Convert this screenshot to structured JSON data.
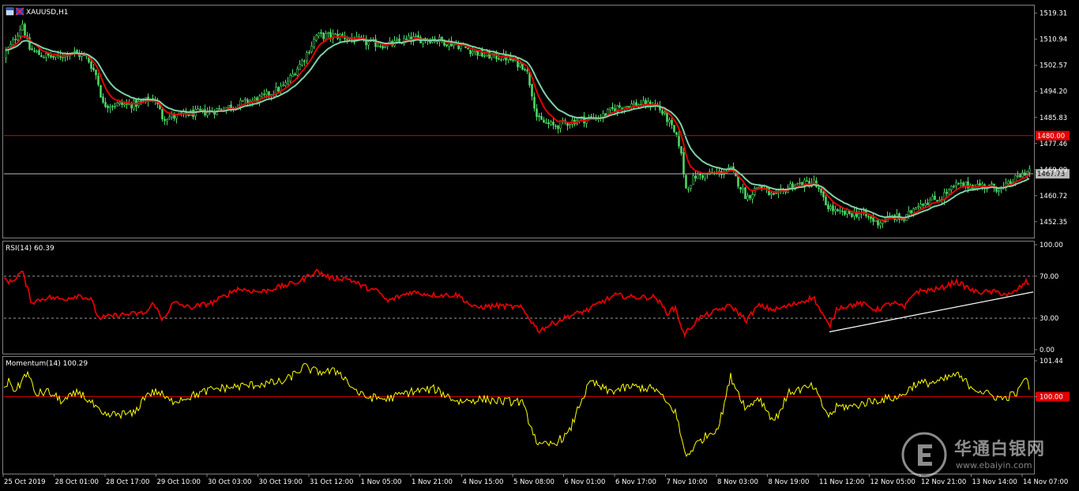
{
  "chart_data": [
    {
      "type": "candlestick",
      "title": "XAUUSD,H1",
      "ylim": [
        1447.5,
        1521.5
      ],
      "y_ticks": [
        "1519.31",
        "1510.94",
        "1502.57",
        "1494.20",
        "1485.83",
        "1477.46",
        "1469.09",
        "1460.72",
        "1452.35"
      ],
      "horizontal_lines": [
        {
          "value": 1480.0,
          "label": "1480.00",
          "color": "#e10000"
        },
        {
          "value": 1467.73,
          "label": "1467.73",
          "color": "#b8b8b8"
        }
      ],
      "moving_averages": [
        {
          "color": "#e10000"
        },
        {
          "color": "#7fd1a8"
        }
      ],
      "close_anchors": [
        {
          "x": 0,
          "y": 1505
        },
        {
          "x": 14,
          "y": 1509
        },
        {
          "x": 28,
          "y": 1516
        },
        {
          "x": 36,
          "y": 1508
        },
        {
          "x": 50,
          "y": 1506
        },
        {
          "x": 70,
          "y": 1505
        },
        {
          "x": 90,
          "y": 1507
        },
        {
          "x": 110,
          "y": 1505
        },
        {
          "x": 122,
          "y": 1499
        },
        {
          "x": 130,
          "y": 1490
        },
        {
          "x": 150,
          "y": 1490
        },
        {
          "x": 170,
          "y": 1490
        },
        {
          "x": 195,
          "y": 1492
        },
        {
          "x": 205,
          "y": 1486
        },
        {
          "x": 220,
          "y": 1486
        },
        {
          "x": 240,
          "y": 1487
        },
        {
          "x": 270,
          "y": 1488
        },
        {
          "x": 300,
          "y": 1490
        },
        {
          "x": 330,
          "y": 1492
        },
        {
          "x": 360,
          "y": 1496
        },
        {
          "x": 385,
          "y": 1505
        },
        {
          "x": 400,
          "y": 1512
        },
        {
          "x": 430,
          "y": 1512
        },
        {
          "x": 460,
          "y": 1510
        },
        {
          "x": 490,
          "y": 1509
        },
        {
          "x": 520,
          "y": 1511
        },
        {
          "x": 550,
          "y": 1511
        },
        {
          "x": 580,
          "y": 1509
        },
        {
          "x": 610,
          "y": 1506
        },
        {
          "x": 640,
          "y": 1505
        },
        {
          "x": 665,
          "y": 1502
        },
        {
          "x": 672,
          "y": 1495
        },
        {
          "x": 680,
          "y": 1485
        },
        {
          "x": 700,
          "y": 1483
        },
        {
          "x": 730,
          "y": 1485
        },
        {
          "x": 760,
          "y": 1486
        },
        {
          "x": 780,
          "y": 1489
        },
        {
          "x": 800,
          "y": 1490
        },
        {
          "x": 830,
          "y": 1490
        },
        {
          "x": 845,
          "y": 1485
        },
        {
          "x": 860,
          "y": 1477
        },
        {
          "x": 868,
          "y": 1463
        },
        {
          "x": 880,
          "y": 1467
        },
        {
          "x": 910,
          "y": 1468
        },
        {
          "x": 925,
          "y": 1469
        },
        {
          "x": 945,
          "y": 1460
        },
        {
          "x": 960,
          "y": 1464
        },
        {
          "x": 980,
          "y": 1460
        },
        {
          "x": 1000,
          "y": 1464
        },
        {
          "x": 1030,
          "y": 1465
        },
        {
          "x": 1045,
          "y": 1458
        },
        {
          "x": 1060,
          "y": 1455
        },
        {
          "x": 1090,
          "y": 1455
        },
        {
          "x": 1110,
          "y": 1452
        },
        {
          "x": 1130,
          "y": 1454
        },
        {
          "x": 1145,
          "y": 1453
        },
        {
          "x": 1160,
          "y": 1458
        },
        {
          "x": 1190,
          "y": 1460
        },
        {
          "x": 1210,
          "y": 1464
        },
        {
          "x": 1240,
          "y": 1464
        },
        {
          "x": 1270,
          "y": 1463
        },
        {
          "x": 1290,
          "y": 1467
        },
        {
          "x": 1302,
          "y": 1469
        }
      ]
    },
    {
      "type": "line",
      "title": "RSI(14) 60.39",
      "ylim": [
        0,
        100
      ],
      "y_ticks": [
        "100.00",
        "70.00",
        "30.00",
        "0.00"
      ],
      "levels": [
        70,
        30
      ],
      "series_color": "#e10000",
      "trendline": {
        "from": {
          "x": 1050,
          "y": 17
        },
        "to": {
          "x": 1308,
          "y": 55
        },
        "color": "#ffffff"
      },
      "anchors": [
        {
          "x": 0,
          "y": 70
        },
        {
          "x": 14,
          "y": 64
        },
        {
          "x": 28,
          "y": 75
        },
        {
          "x": 40,
          "y": 45
        },
        {
          "x": 60,
          "y": 50
        },
        {
          "x": 80,
          "y": 48
        },
        {
          "x": 100,
          "y": 52
        },
        {
          "x": 115,
          "y": 48
        },
        {
          "x": 125,
          "y": 30
        },
        {
          "x": 150,
          "y": 33
        },
        {
          "x": 185,
          "y": 35
        },
        {
          "x": 195,
          "y": 45
        },
        {
          "x": 205,
          "y": 28
        },
        {
          "x": 220,
          "y": 45
        },
        {
          "x": 240,
          "y": 40
        },
        {
          "x": 270,
          "y": 45
        },
        {
          "x": 300,
          "y": 58
        },
        {
          "x": 330,
          "y": 55
        },
        {
          "x": 355,
          "y": 60
        },
        {
          "x": 380,
          "y": 65
        },
        {
          "x": 400,
          "y": 75
        },
        {
          "x": 420,
          "y": 68
        },
        {
          "x": 440,
          "y": 68
        },
        {
          "x": 460,
          "y": 60
        },
        {
          "x": 480,
          "y": 55
        },
        {
          "x": 490,
          "y": 46
        },
        {
          "x": 520,
          "y": 55
        },
        {
          "x": 550,
          "y": 52
        },
        {
          "x": 580,
          "y": 52
        },
        {
          "x": 600,
          "y": 40
        },
        {
          "x": 630,
          "y": 42
        },
        {
          "x": 660,
          "y": 40
        },
        {
          "x": 670,
          "y": 30
        },
        {
          "x": 682,
          "y": 18
        },
        {
          "x": 700,
          "y": 25
        },
        {
          "x": 720,
          "y": 32
        },
        {
          "x": 745,
          "y": 38
        },
        {
          "x": 760,
          "y": 45
        },
        {
          "x": 780,
          "y": 52
        },
        {
          "x": 800,
          "y": 50
        },
        {
          "x": 830,
          "y": 50
        },
        {
          "x": 845,
          "y": 35
        },
        {
          "x": 855,
          "y": 40
        },
        {
          "x": 866,
          "y": 14
        },
        {
          "x": 885,
          "y": 30
        },
        {
          "x": 910,
          "y": 38
        },
        {
          "x": 925,
          "y": 42
        },
        {
          "x": 945,
          "y": 28
        },
        {
          "x": 960,
          "y": 42
        },
        {
          "x": 980,
          "y": 38
        },
        {
          "x": 1000,
          "y": 42
        },
        {
          "x": 1030,
          "y": 50
        },
        {
          "x": 1040,
          "y": 35
        },
        {
          "x": 1050,
          "y": 22
        },
        {
          "x": 1060,
          "y": 40
        },
        {
          "x": 1090,
          "y": 44
        },
        {
          "x": 1110,
          "y": 38
        },
        {
          "x": 1130,
          "y": 45
        },
        {
          "x": 1145,
          "y": 40
        },
        {
          "x": 1158,
          "y": 55
        },
        {
          "x": 1190,
          "y": 58
        },
        {
          "x": 1210,
          "y": 65
        },
        {
          "x": 1235,
          "y": 55
        },
        {
          "x": 1260,
          "y": 55
        },
        {
          "x": 1280,
          "y": 52
        },
        {
          "x": 1300,
          "y": 65
        },
        {
          "x": 1304,
          "y": 60
        }
      ]
    },
    {
      "type": "line",
      "title": "Momentum(14) 100.29",
      "ylim": [
        97.0,
        101.44
      ],
      "y_ticks": [
        "101.44",
        "100.00"
      ],
      "levels": [
        100.0
      ],
      "level_color": "#e10000",
      "series_color": "#ffff00",
      "anchors": [
        {
          "x": 0,
          "y": 100.3
        },
        {
          "x": 12,
          "y": 100.6
        },
        {
          "x": 20,
          "y": 100.2
        },
        {
          "x": 34,
          "y": 101.0
        },
        {
          "x": 45,
          "y": 100.1
        },
        {
          "x": 60,
          "y": 100.2
        },
        {
          "x": 80,
          "y": 99.8
        },
        {
          "x": 100,
          "y": 100.2
        },
        {
          "x": 120,
          "y": 99.6
        },
        {
          "x": 130,
          "y": 99.2
        },
        {
          "x": 150,
          "y": 99.3
        },
        {
          "x": 170,
          "y": 99.3
        },
        {
          "x": 185,
          "y": 100.1
        },
        {
          "x": 200,
          "y": 100.2
        },
        {
          "x": 215,
          "y": 99.8
        },
        {
          "x": 240,
          "y": 100.0
        },
        {
          "x": 270,
          "y": 100.3
        },
        {
          "x": 300,
          "y": 100.4
        },
        {
          "x": 330,
          "y": 100.5
        },
        {
          "x": 360,
          "y": 100.6
        },
        {
          "x": 385,
          "y": 101.2
        },
        {
          "x": 400,
          "y": 101.0
        },
        {
          "x": 430,
          "y": 101.0
        },
        {
          "x": 445,
          "y": 100.4
        },
        {
          "x": 460,
          "y": 100.0
        },
        {
          "x": 490,
          "y": 99.9
        },
        {
          "x": 520,
          "y": 100.2
        },
        {
          "x": 550,
          "y": 100.3
        },
        {
          "x": 580,
          "y": 99.8
        },
        {
          "x": 610,
          "y": 99.9
        },
        {
          "x": 640,
          "y": 99.8
        },
        {
          "x": 660,
          "y": 99.8
        },
        {
          "x": 670,
          "y": 99.0
        },
        {
          "x": 682,
          "y": 98.0
        },
        {
          "x": 700,
          "y": 98.1
        },
        {
          "x": 720,
          "y": 98.5
        },
        {
          "x": 735,
          "y": 99.8
        },
        {
          "x": 748,
          "y": 100.6
        },
        {
          "x": 770,
          "y": 100.2
        },
        {
          "x": 800,
          "y": 100.4
        },
        {
          "x": 830,
          "y": 100.3
        },
        {
          "x": 845,
          "y": 99.7
        },
        {
          "x": 855,
          "y": 99.4
        },
        {
          "x": 868,
          "y": 97.6
        },
        {
          "x": 885,
          "y": 98.2
        },
        {
          "x": 910,
          "y": 98.8
        },
        {
          "x": 925,
          "y": 100.8
        },
        {
          "x": 945,
          "y": 99.5
        },
        {
          "x": 960,
          "y": 100.0
        },
        {
          "x": 980,
          "y": 99.0
        },
        {
          "x": 1000,
          "y": 100.2
        },
        {
          "x": 1030,
          "y": 100.4
        },
        {
          "x": 1040,
          "y": 99.7
        },
        {
          "x": 1050,
          "y": 99.2
        },
        {
          "x": 1060,
          "y": 99.6
        },
        {
          "x": 1080,
          "y": 99.6
        },
        {
          "x": 1100,
          "y": 99.8
        },
        {
          "x": 1120,
          "y": 99.9
        },
        {
          "x": 1140,
          "y": 100.0
        },
        {
          "x": 1158,
          "y": 100.5
        },
        {
          "x": 1190,
          "y": 100.6
        },
        {
          "x": 1210,
          "y": 100.9
        },
        {
          "x": 1230,
          "y": 100.4
        },
        {
          "x": 1250,
          "y": 100.1
        },
        {
          "x": 1270,
          "y": 99.9
        },
        {
          "x": 1290,
          "y": 100.2
        },
        {
          "x": 1297,
          "y": 100.8
        },
        {
          "x": 1304,
          "y": 100.3
        }
      ]
    }
  ],
  "x_axis_labels": [
    "25 Oct 2019",
    "28 Oct 01:00",
    "28 Oct 17:00",
    "29 Oct 10:00",
    "30 Oct 03:00",
    "30 Oct 19:00",
    "31 Oct 12:00",
    "1 Nov 05:00",
    "1 Nov 21:00",
    "4 Nov 15:00",
    "5 Nov 08:00",
    "6 Nov 01:00",
    "6 Nov 17:00",
    "7 Nov 10:00",
    "8 Nov 03:00",
    "8 Nov 19:00",
    "11 Nov 12:00",
    "12 Nov 05:00",
    "12 Nov 21:00",
    "13 Nov 14:00",
    "14 Nov 07:00"
  ],
  "colors": {
    "background": "#000000",
    "bull_candle": "#4cd964",
    "frame": "#808080"
  },
  "watermark": {
    "text": "华通白银网",
    "url": "www.ebaiyin.com",
    "icon": "e-logo-icon"
  }
}
